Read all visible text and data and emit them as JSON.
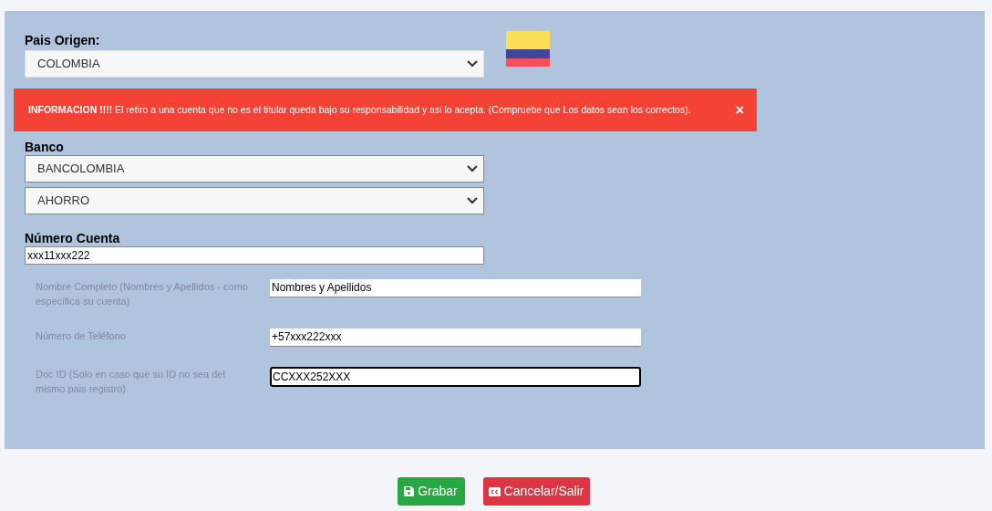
{
  "country": {
    "label": "Pais Origen:",
    "value": "COLOMBIA"
  },
  "alert": {
    "message": "**INFORMACION !!!!** El retiro a una cuenta que no es el titular queda bajo su responsabilidad y asi lo acepta. (Compruebe que Los datos sean los correctos).",
    "close": "×"
  },
  "bank": {
    "label": "Banco",
    "bank_value": "BANCOLOMBIA",
    "account_type_value": "AHORRO"
  },
  "account": {
    "label": "Número Cuenta",
    "value": "xxx11xxx222"
  },
  "fields": [
    {
      "label": "Nombre Completo (Nombres y Apellidos - como especifica su cuenta)",
      "value": "Nombres y Apellidos",
      "focused": false
    },
    {
      "label": "Número de Teléfono",
      "value": "+57xxx222xxx",
      "focused": false
    },
    {
      "label": "Doc ID (Solo en caso que su ID no sea del mismo pais registro)",
      "value": "CCXXX252XXX",
      "focused": true
    }
  ],
  "buttons": [
    {
      "label": "Grabar",
      "kind": "save"
    },
    {
      "label": "Cancelar/Salir",
      "kind": "cancel"
    }
  ]
}
